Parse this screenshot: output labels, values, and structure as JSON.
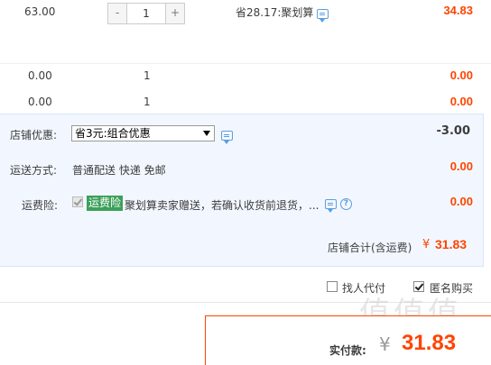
{
  "item": {
    "unit_price": "63.00",
    "quantity": "1",
    "minus": "-",
    "plus": "+",
    "discount_note": "省28.17:聚划算",
    "subtotal": "34.83"
  },
  "bonus_rows": [
    {
      "price": "0.00",
      "qty": "1",
      "subtotal": "0.00"
    },
    {
      "price": "0.00",
      "qty": "1",
      "subtotal": "0.00"
    }
  ],
  "shop_discount": {
    "label": "店铺优惠:",
    "selected": "省3元:组合优惠",
    "amount": "-3.00"
  },
  "shipping": {
    "label": "运送方式:",
    "value": "普通配送 快递 免邮",
    "amount": "0.00"
  },
  "insurance": {
    "label": "运费险:",
    "tag": "运费险",
    "desc": "聚划算卖家赠送，若确认收货前退货，...",
    "amount": "0.00",
    "help": "?"
  },
  "shop_total": {
    "label": "店铺合计(含运费)",
    "currency": "¥",
    "value": "31.83"
  },
  "options": {
    "proxy_pay": "找人代付",
    "anonymous": "匿名购买"
  },
  "payment": {
    "label": "实付款:",
    "currency": "¥",
    "value": "31.83"
  },
  "watermark": "值值值"
}
